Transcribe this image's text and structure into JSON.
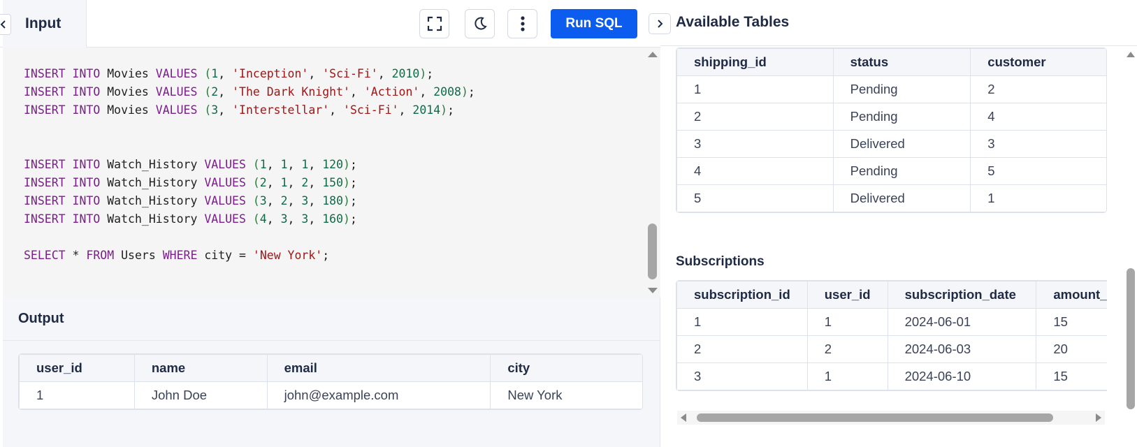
{
  "toolbar": {
    "tab_label": "Input",
    "run_label": "Run SQL",
    "icons": [
      "chevron-left-icon",
      "fullscreen-icon",
      "moon-icon",
      "more-vertical-icon",
      "chevron-right-icon"
    ]
  },
  "editor": {
    "lines": [
      "INSERT INTO Movies VALUES (1, 'Inception', 'Sci-Fi', 2010);",
      "INSERT INTO Movies VALUES (2, 'The Dark Knight', 'Action', 2008);",
      "INSERT INTO Movies VALUES (3, 'Interstellar', 'Sci-Fi', 2014);",
      "INSERT INTO Watch_History VALUES (1, 1, 1, 120);",
      "INSERT INTO Watch_History VALUES (2, 1, 2, 150);",
      "INSERT INTO Watch_History VALUES (3, 2, 3, 180);",
      "INSERT INTO Watch_History VALUES (4, 3, 3, 160);",
      "SELECT * FROM Users WHERE city = 'New York';"
    ]
  },
  "output": {
    "title": "Output",
    "columns": [
      "user_id",
      "name",
      "email",
      "city"
    ],
    "rows": [
      [
        "1",
        "John Doe",
        "john@example.com",
        "New York"
      ]
    ]
  },
  "available": {
    "title": "Available Tables",
    "shipping": {
      "columns": [
        "shipping_id",
        "status",
        "customer"
      ],
      "rows": [
        [
          "1",
          "Pending",
          "2"
        ],
        [
          "2",
          "Pending",
          "4"
        ],
        [
          "3",
          "Delivered",
          "3"
        ],
        [
          "4",
          "Pending",
          "5"
        ],
        [
          "5",
          "Delivered",
          "1"
        ]
      ]
    },
    "subscriptions": {
      "title": "Subscriptions",
      "columns": [
        "subscription_id",
        "user_id",
        "subscription_date",
        "amount_"
      ],
      "rows": [
        [
          "1",
          "1",
          "2024-06-01",
          "15"
        ],
        [
          "2",
          "2",
          "2024-06-03",
          "20"
        ],
        [
          "3",
          "1",
          "2024-06-10",
          "15"
        ]
      ]
    }
  },
  "colors": {
    "accent": "#0d5cf0",
    "keyword": "#7a1e8a",
    "string": "#a31515",
    "number": "#0f6b47"
  }
}
